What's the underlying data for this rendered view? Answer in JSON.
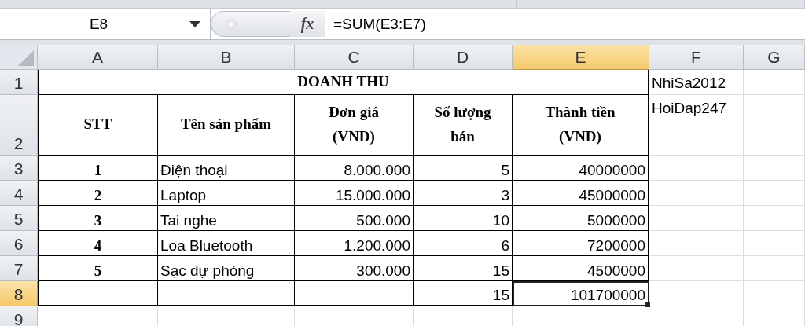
{
  "formula_bar": {
    "name_box": "E8",
    "fx": "fx",
    "formula": "=SUM(E3:E7)"
  },
  "columns": [
    {
      "label": "A",
      "selected": false
    },
    {
      "label": "B",
      "selected": false
    },
    {
      "label": "C",
      "selected": false
    },
    {
      "label": "D",
      "selected": false
    },
    {
      "label": "E",
      "selected": true
    },
    {
      "label": "F",
      "selected": false
    },
    {
      "label": "G",
      "selected": false
    }
  ],
  "rows": [
    {
      "number": "1",
      "selected": false,
      "cells": [
        {
          "kind": "title",
          "text": "DOANH THU",
          "selected": false
        },
        {
          "kind": "note",
          "text": "NhiSa2012",
          "selected": false
        }
      ]
    },
    {
      "number": "2",
      "selected": false,
      "cells": [
        {
          "kind": "header",
          "text": "STT",
          "selected": false
        },
        {
          "kind": "header",
          "text": "Tên sản phẩm",
          "selected": false
        },
        {
          "kind": "header",
          "text": "Đơn giá\n(VND)",
          "selected": false
        },
        {
          "kind": "header",
          "text": "Số lượng\nbán",
          "selected": false
        },
        {
          "kind": "header",
          "text": "Thành tiền\n(VND)",
          "selected": false
        },
        {
          "kind": "note",
          "text": "HoiDap247",
          "selected": false
        }
      ]
    },
    {
      "number": "3",
      "selected": false,
      "cells": [
        {
          "kind": "index",
          "text": "1",
          "selected": false
        },
        {
          "kind": "text",
          "text": "Điện thoại",
          "selected": false
        },
        {
          "kind": "number",
          "text": "8.000.000",
          "selected": false
        },
        {
          "kind": "number",
          "text": "5",
          "selected": false
        },
        {
          "kind": "number",
          "text": "40000000",
          "selected": false
        }
      ]
    },
    {
      "number": "4",
      "selected": false,
      "cells": [
        {
          "kind": "index",
          "text": "2",
          "selected": false
        },
        {
          "kind": "text",
          "text": "Laptop",
          "selected": false
        },
        {
          "kind": "number",
          "text": "15.000.000",
          "selected": false
        },
        {
          "kind": "number",
          "text": "3",
          "selected": false
        },
        {
          "kind": "number",
          "text": "45000000",
          "selected": false
        }
      ]
    },
    {
      "number": "5",
      "selected": false,
      "cells": [
        {
          "kind": "index",
          "text": "3",
          "selected": false
        },
        {
          "kind": "text",
          "text": "Tai nghe",
          "selected": false
        },
        {
          "kind": "number",
          "text": "500.000",
          "selected": false
        },
        {
          "kind": "number",
          "text": "10",
          "selected": false
        },
        {
          "kind": "number",
          "text": "5000000",
          "selected": false
        }
      ]
    },
    {
      "number": "6",
      "selected": false,
      "cells": [
        {
          "kind": "index",
          "text": "4",
          "selected": false
        },
        {
          "kind": "text",
          "text": "Loa Bluetooth",
          "selected": false
        },
        {
          "kind": "number",
          "text": "1.200.000",
          "selected": false
        },
        {
          "kind": "number",
          "text": "6",
          "selected": false
        },
        {
          "kind": "number",
          "text": "7200000",
          "selected": false
        }
      ]
    },
    {
      "number": "7",
      "selected": false,
      "cells": [
        {
          "kind": "index",
          "text": "5",
          "selected": false
        },
        {
          "kind": "text",
          "text": "Sạc dự phòng",
          "selected": false
        },
        {
          "kind": "number",
          "text": "300.000",
          "selected": false
        },
        {
          "kind": "number",
          "text": "15",
          "selected": false
        },
        {
          "kind": "number",
          "text": "4500000",
          "selected": false
        }
      ]
    },
    {
      "number": "8",
      "selected": true,
      "cells": [
        {
          "kind": "empty",
          "selected": false
        },
        {
          "kind": "empty",
          "selected": false
        },
        {
          "kind": "empty",
          "selected": false
        },
        {
          "kind": "number",
          "text": "15",
          "selected": false
        },
        {
          "kind": "number",
          "text": "101700000",
          "selected": true
        }
      ]
    },
    {
      "number": "9",
      "selected": false,
      "cells": []
    }
  ]
}
